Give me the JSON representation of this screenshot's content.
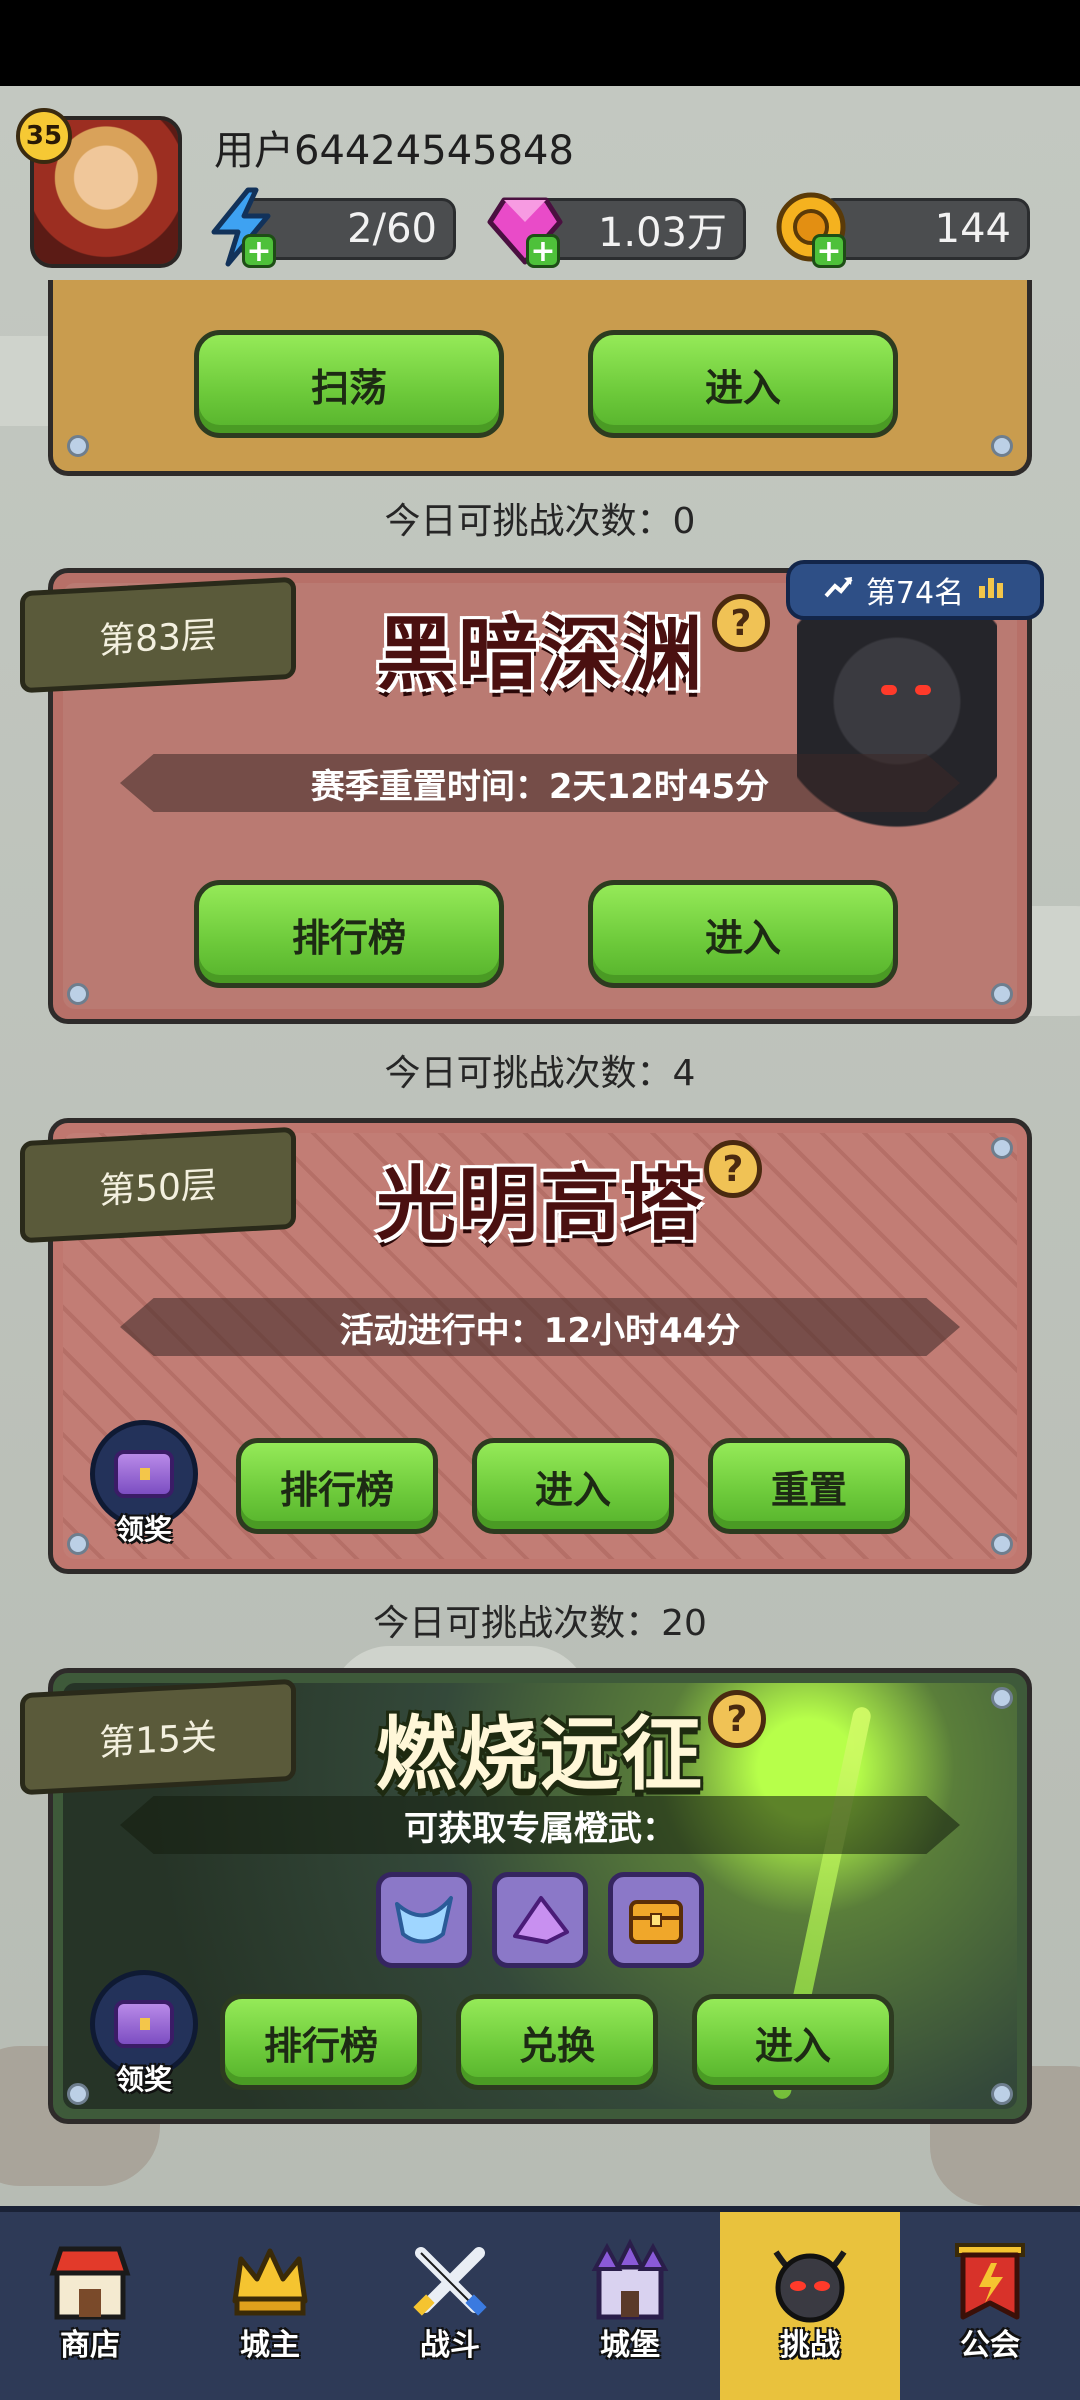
{
  "user": {
    "level": "35",
    "name": "用户64424545848"
  },
  "resources": {
    "energy": "2/60",
    "gems": "1.03万",
    "coins": "144"
  },
  "panel1": {
    "btn_sweep": "扫荡",
    "btn_enter": "进入",
    "challenge": "今日可挑战次数：0"
  },
  "panel2": {
    "floor": "第83层",
    "title": "黑暗深渊",
    "help": "?",
    "rank": "第74名",
    "info": "赛季重置时间：2天12时45分",
    "btn_rank": "排行榜",
    "btn_enter": "进入",
    "challenge": "今日可挑战次数：4"
  },
  "panel3": {
    "floor": "第50层",
    "title": "光明高塔",
    "help": "?",
    "info": "活动进行中：12小时44分",
    "reward_label": "领奖",
    "btn_rank": "排行榜",
    "btn_enter": "进入",
    "btn_reset": "重置",
    "challenge": "今日可挑战次数：20"
  },
  "panel4": {
    "stage": "第15关",
    "title": "燃烧远征",
    "help": "?",
    "info": "可获取专属橙武：",
    "reward_label": "领奖",
    "btn_rank": "排行榜",
    "btn_exchange": "兑换",
    "btn_enter": "进入"
  },
  "nav": [
    {
      "label": "商店",
      "icon": "shop-icon"
    },
    {
      "label": "城主",
      "icon": "crown-icon"
    },
    {
      "label": "战斗",
      "icon": "swords-icon"
    },
    {
      "label": "城堡",
      "icon": "castle-icon"
    },
    {
      "label": "挑战",
      "icon": "demon-icon",
      "active": true
    },
    {
      "label": "公会",
      "icon": "guild-banner-icon"
    }
  ],
  "colors": {
    "button_green": "#6cc93a",
    "nav_bg": "#2e3a57",
    "nav_active": "#e9c23d"
  }
}
